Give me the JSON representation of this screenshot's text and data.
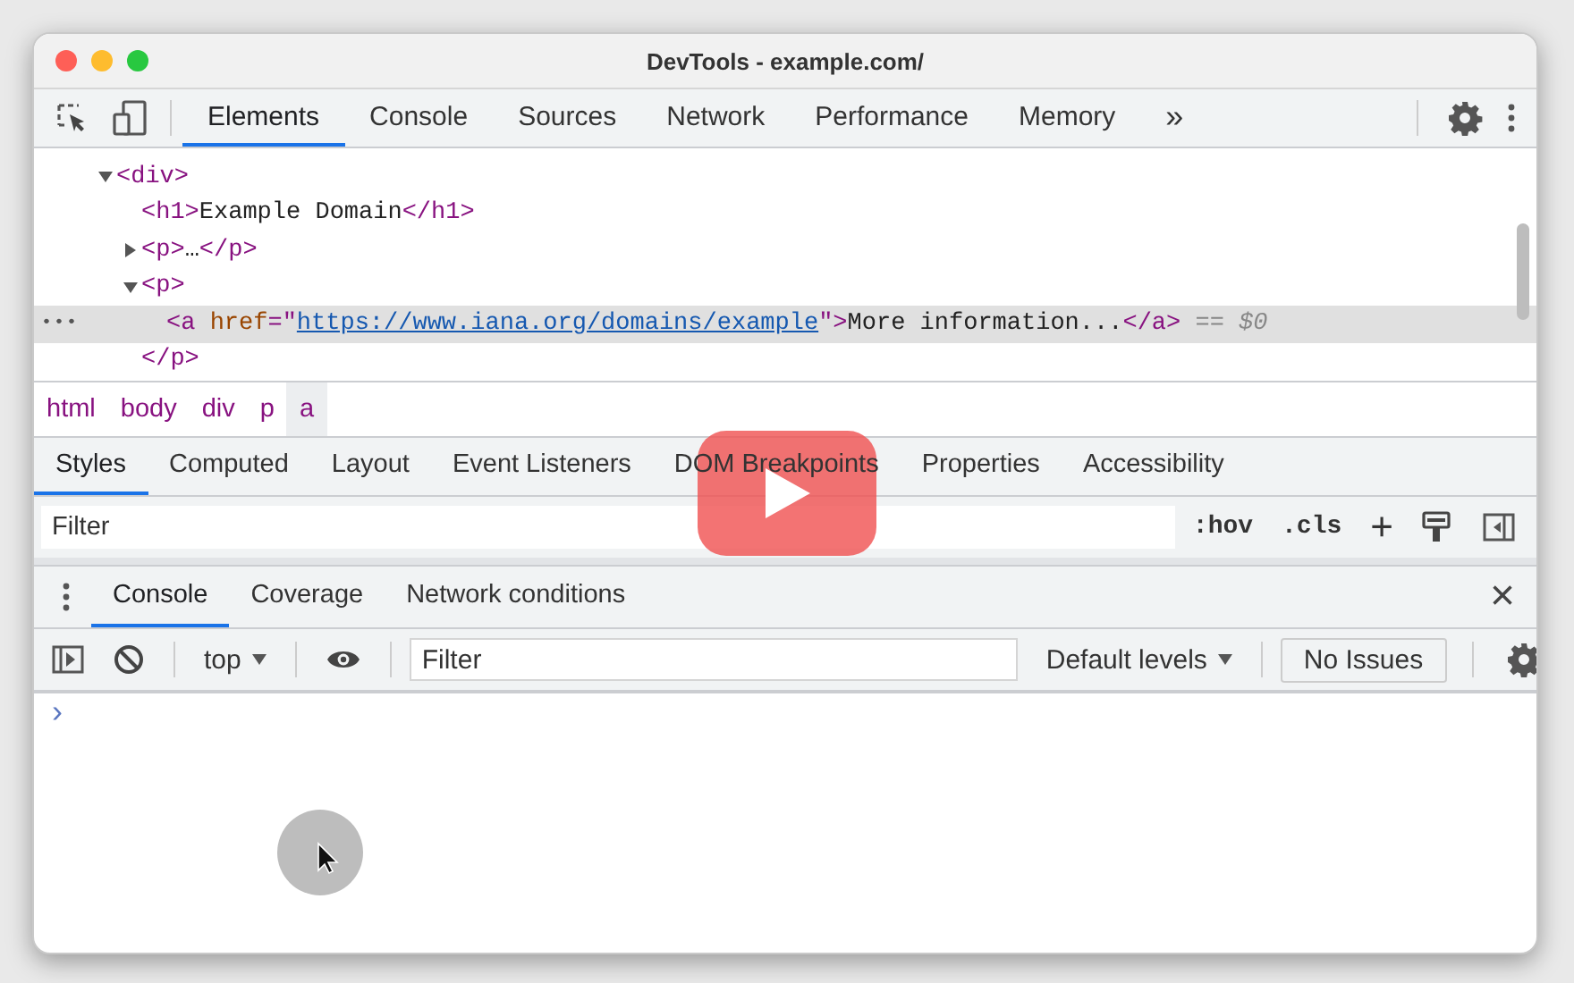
{
  "window": {
    "title": "DevTools - example.com/"
  },
  "main_tabs": [
    {
      "label": "Elements",
      "selected": true
    },
    {
      "label": "Console",
      "selected": false
    },
    {
      "label": "Sources",
      "selected": false
    },
    {
      "label": "Network",
      "selected": false
    },
    {
      "label": "Performance",
      "selected": false
    },
    {
      "label": "Memory",
      "selected": false
    }
  ],
  "more_tabs": "»",
  "dom_tree": [
    {
      "expanded": true,
      "selected": false,
      "open": [
        {
          "kind": "tag",
          "text": "<div>"
        }
      ],
      "children": [
        {
          "selected": false,
          "open": [
            {
              "kind": "tag",
              "text": "<h1>"
            },
            {
              "kind": "text",
              "text": "Example Domain"
            },
            {
              "kind": "tag",
              "text": "</h1>"
            }
          ]
        },
        {
          "expanded": false,
          "selected": false,
          "open": [
            {
              "kind": "tag",
              "text": "<p>"
            },
            {
              "kind": "text",
              "text": "…"
            },
            {
              "kind": "tag",
              "text": "</p>"
            }
          ]
        },
        {
          "expanded": true,
          "selected": false,
          "open": [
            {
              "kind": "tag",
              "text": "<p>"
            }
          ],
          "close": [
            {
              "kind": "tag",
              "text": "</p>"
            }
          ],
          "children": [
            {
              "selected": true,
              "open": [
                {
                  "kind": "tag",
                  "text": "<a "
                },
                {
                  "kind": "attr",
                  "text": "href"
                },
                {
                  "kind": "tag",
                  "text": "=\""
                },
                {
                  "kind": "link",
                  "text": "https://www.iana.org/domains/example"
                },
                {
                  "kind": "tag",
                  "text": "\">"
                },
                {
                  "kind": "text",
                  "text": "More information..."
                },
                {
                  "kind": "tag",
                  "text": "</a>"
                },
                {
                  "kind": "marker",
                  "text": " == $0"
                }
              ]
            }
          ]
        }
      ]
    }
  ],
  "selected_marker": "•••",
  "breadcrumbs": [
    {
      "label": "html",
      "selected": false
    },
    {
      "label": "body",
      "selected": false
    },
    {
      "label": "div",
      "selected": false
    },
    {
      "label": "p",
      "selected": false
    },
    {
      "label": "a",
      "selected": true
    }
  ],
  "styles_tabs": [
    {
      "label": "Styles",
      "selected": true
    },
    {
      "label": "Computed",
      "selected": false
    },
    {
      "label": "Layout",
      "selected": false
    },
    {
      "label": "Event Listeners",
      "selected": false
    },
    {
      "label": "DOM Breakpoints",
      "selected": false
    },
    {
      "label": "Properties",
      "selected": false
    },
    {
      "label": "Accessibility",
      "selected": false
    }
  ],
  "styles_filter": {
    "placeholder": "Filter"
  },
  "styles_buttons": [
    ":hov",
    ".cls",
    "+"
  ],
  "drawer_tabs": [
    {
      "label": "Console",
      "selected": true
    },
    {
      "label": "Coverage",
      "selected": false
    },
    {
      "label": "Network conditions",
      "selected": false
    }
  ],
  "close": "×",
  "console_toolbar": {
    "context": "top",
    "filter": {
      "placeholder": "Filter"
    },
    "levels": "Default levels",
    "issues": "No Issues"
  },
  "prompt": "›",
  "overlay": {
    "play_button": true,
    "cursor": true
  }
}
